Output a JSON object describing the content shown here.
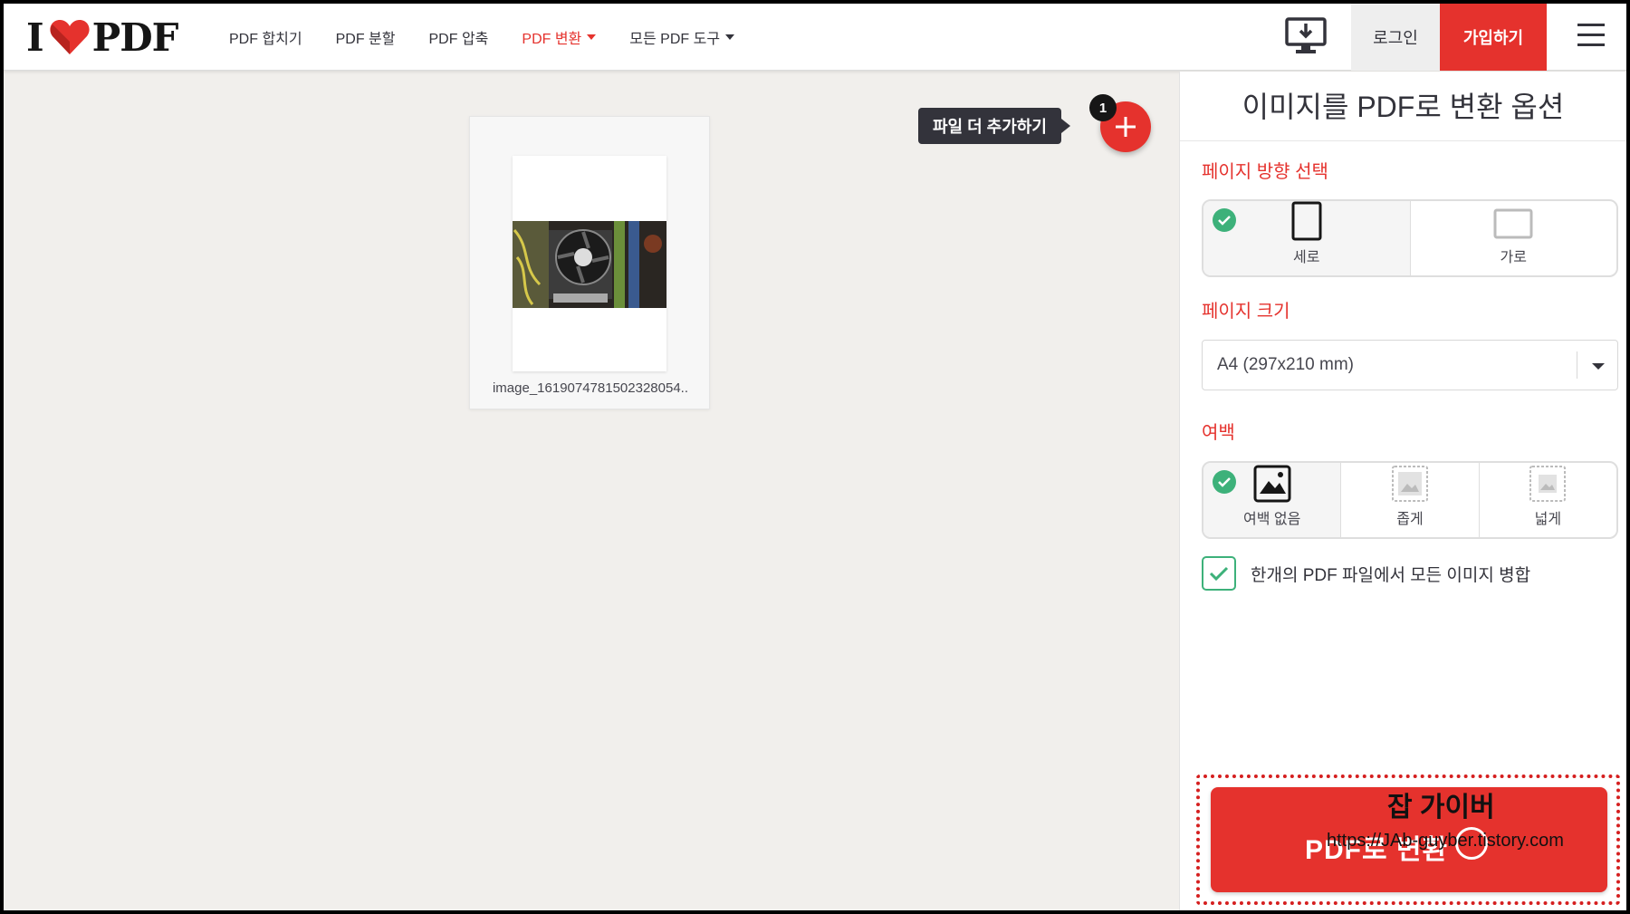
{
  "header": {
    "logo_prefix": "I",
    "logo_suffix": "PDF",
    "nav": [
      {
        "label": "PDF 합치기"
      },
      {
        "label": "PDF 분할"
      },
      {
        "label": "PDF 압축"
      },
      {
        "label": "PDF 변환",
        "active": true,
        "dropdown": true
      },
      {
        "label": "모든 PDF 도구",
        "dropdown": true
      }
    ],
    "desktop_icon": "desktop-download-icon",
    "login_label": "로그인",
    "signup_label": "가입하기",
    "menu_icon": "hamburger-menu-icon"
  },
  "workspace": {
    "file": {
      "name": "image_1619074781502328054..",
      "thumbnail": "computer-cpu-cooler-photo"
    },
    "add_tooltip": "파일 더 추가하기",
    "file_count": "1"
  },
  "sidebar": {
    "title": "이미지를 PDF로 변환 옵션",
    "orientation": {
      "label": "페이지 방향 선택",
      "options": [
        {
          "label": "세로",
          "selected": true
        },
        {
          "label": "가로",
          "selected": false
        }
      ]
    },
    "page_size": {
      "label": "페이지 크기",
      "value": "A4 (297x210 mm)"
    },
    "margin": {
      "label": "여백",
      "options": [
        {
          "label": "여백 없음",
          "selected": true
        },
        {
          "label": "좁게",
          "selected": false
        },
        {
          "label": "넓게",
          "selected": false
        }
      ]
    },
    "merge": {
      "label": "한개의 PDF 파일에서 모든 이미지 병합",
      "checked": true
    },
    "convert_label": "PDF로 변환"
  },
  "watermark": {
    "title": "잡 가이버",
    "url": "https://JAb-guyber.tistory.com"
  },
  "colors": {
    "accent": "#e5322d",
    "check": "#3db17a",
    "dark": "#33333b",
    "background": "#f1efec"
  }
}
